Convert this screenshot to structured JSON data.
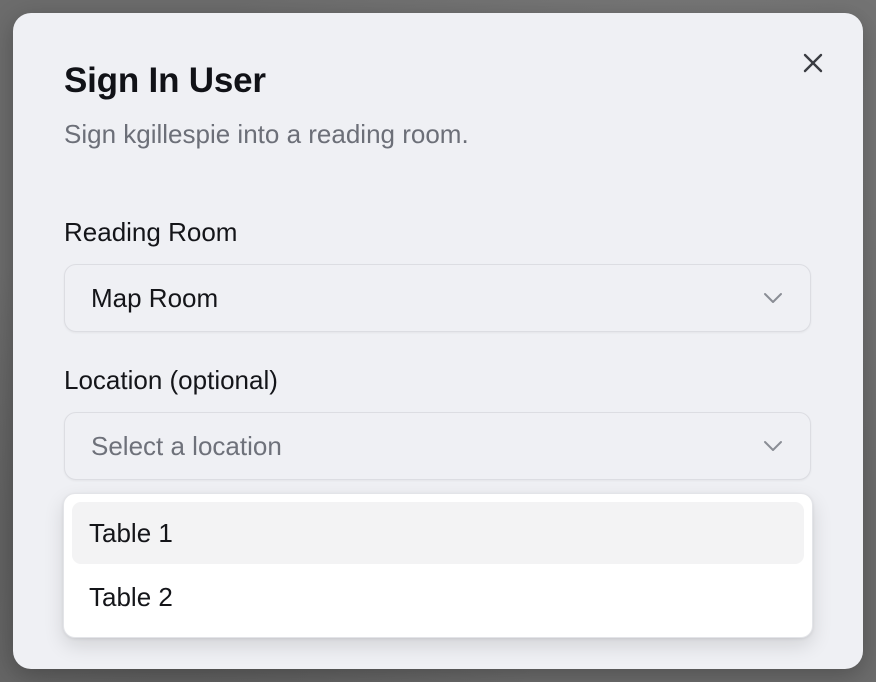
{
  "dialog": {
    "title": "Sign In User",
    "subtitle": "Sign kgillespie into a reading room.",
    "close_icon": "close-icon"
  },
  "reading_room": {
    "label": "Reading Room",
    "selected_value": "Map Room",
    "icon": "chevron-down-icon"
  },
  "location": {
    "label": "Location (optional)",
    "placeholder": "Select a location",
    "icon": "chevron-down-icon",
    "options": [
      {
        "label": "Table 1",
        "highlighted": true
      },
      {
        "label": "Table 2",
        "highlighted": false
      }
    ]
  },
  "colors": {
    "dialog_bg": "#eff0f4",
    "text_primary": "#141519",
    "text_muted": "#6c6f78",
    "highlight_bg": "#f3f3f4"
  }
}
